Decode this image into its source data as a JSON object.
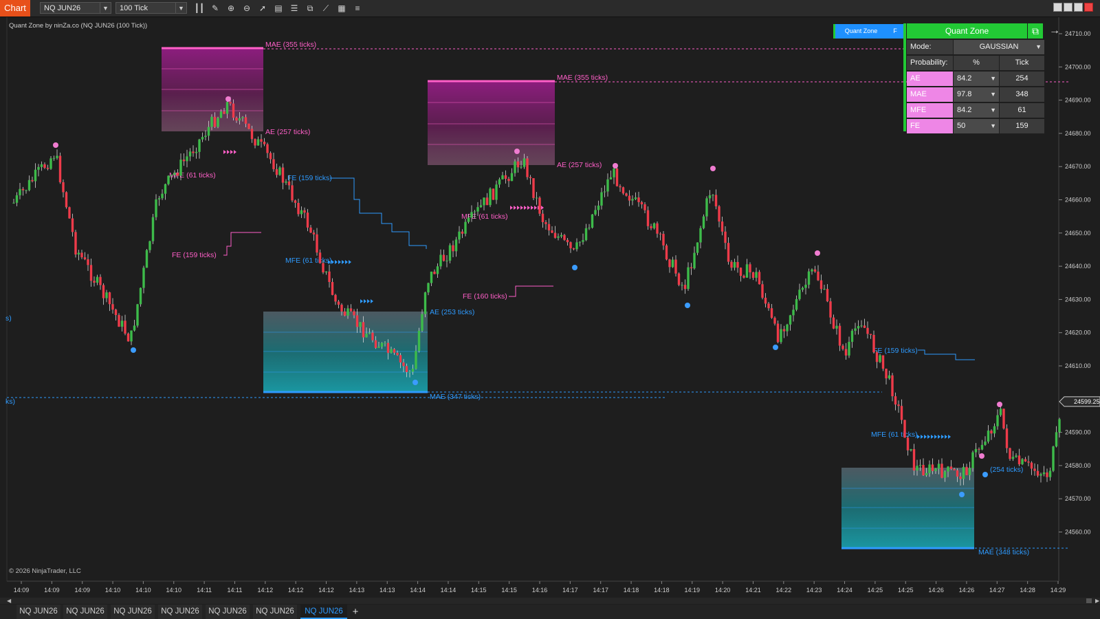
{
  "toolbar": {
    "chart_button": "Chart",
    "instrument": "NQ JUN26",
    "interval": "100 Tick",
    "icons": [
      "bar-style-icon",
      "draw-pencil-icon",
      "zoom-in-icon",
      "zoom-out-icon",
      "pointer-icon",
      "data-box-icon",
      "templates-icon",
      "drawing-tools-icon",
      "strategy-icon",
      "properties-icon",
      "list-icon"
    ]
  },
  "chart_label": "Quant Zone by ninZa.co (NQ JUN26 (100 Tick))",
  "copyright": "© 2026 NinjaTrader, LLC",
  "price_axis": {
    "ticks": [
      "24710.00",
      "24700.00",
      "24690.00",
      "24680.00",
      "24670.00",
      "24660.00",
      "24650.00",
      "24640.00",
      "24630.00",
      "24620.00",
      "24610.00",
      "24590.00",
      "24580.00",
      "24570.00",
      "24560.00"
    ],
    "current_price": "24599.25"
  },
  "time_axis": [
    "14:09",
    "14:09",
    "14:09",
    "14:10",
    "14:10",
    "14:10",
    "14:11",
    "14:11",
    "14:12",
    "14:12",
    "14:12",
    "14:13",
    "14:13",
    "14:14",
    "14:14",
    "14:15",
    "14:15",
    "14:16",
    "14:17",
    "14:17",
    "14:18",
    "14:18",
    "14:19",
    "14:20",
    "14:21",
    "14:22",
    "14:23",
    "14:24",
    "14:25",
    "14:25",
    "14:26",
    "14:26",
    "14:27",
    "14:28",
    "14:29"
  ],
  "zone_labels": {
    "mae1": "MAE (355 ticks)",
    "ae1": "AE (257 ticks)",
    "mfe1": "MFE (61 ticks)",
    "fe1": "FE (159 ticks)",
    "fe2": "FE (159 ticks)",
    "mfe2": "MFE (61 ticks)",
    "ae2": "AE (253 ticks)",
    "mae2": "MAE (347 ticks)",
    "mae3": "MAE (355 ticks)",
    "ae3": "AE (257 ticks)",
    "mfe3": "MFE (61 ticks)",
    "fe3": "FE (160 ticks)",
    "fe4": "FE (159 ticks)",
    "mfe4": "MFE (61 ticks)",
    "ae4": "(254 ticks)",
    "mae4": "MAE (348 ticks)",
    "left_edge_1": "s)",
    "left_edge_2": "ks)"
  },
  "quant_zone": {
    "mini_button": "Quant Zone",
    "mini_f": "F",
    "title": "Quant Zone",
    "mode_label": "Mode:",
    "mode_value": "GAUSSIAN",
    "prob_label": "Probability:",
    "col_pct": "%",
    "col_tick": "Tick",
    "rows": [
      {
        "name": "AE",
        "pct": "84.2",
        "tick": "254"
      },
      {
        "name": "MAE",
        "pct": "97.8",
        "tick": "348"
      },
      {
        "name": "MFE",
        "pct": "84.2",
        "tick": "61"
      },
      {
        "name": "FE",
        "pct": "50",
        "tick": "159"
      }
    ]
  },
  "tabs": [
    "NQ JUN26",
    "NQ JUN26",
    "NQ JUN26",
    "NQ JUN26",
    "NQ JUN26",
    "NQ JUN26",
    "NQ JUN26"
  ],
  "active_tab": 6,
  "colors": {
    "up": "#3dbb4a",
    "down": "#ee3b4a",
    "pink": "#ff5fc8",
    "blue": "#2e9bff",
    "cyan": "#1bb1b5",
    "accent": "#22c935",
    "chart_button": "#e8501a"
  }
}
